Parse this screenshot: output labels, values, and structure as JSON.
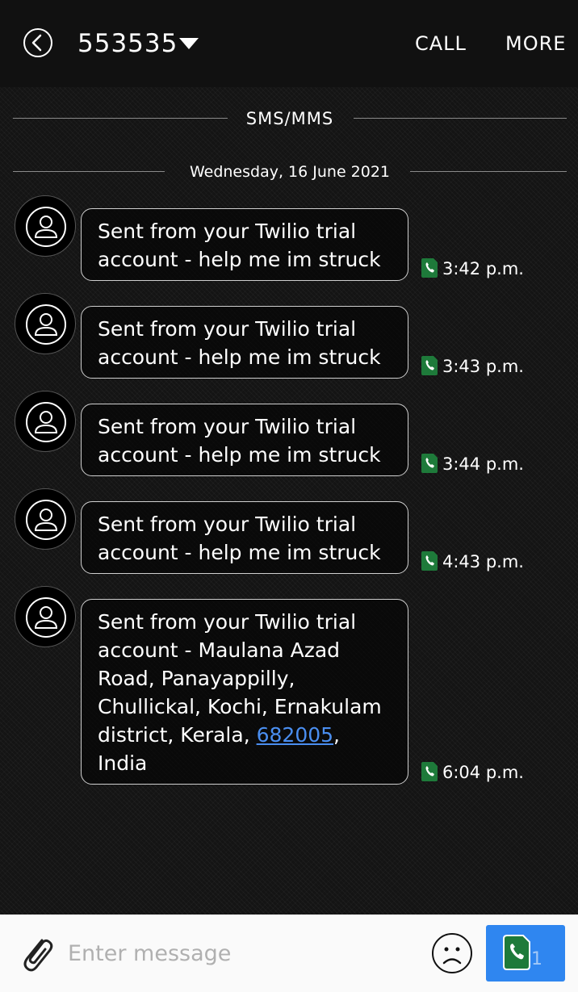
{
  "header": {
    "title": "553535",
    "call_label": "CALL",
    "more_label": "MORE"
  },
  "divider_type": "SMS/MMS",
  "date_label": "Wednesday, 16 June 2021",
  "messages": [
    {
      "text": "Sent from your Twilio trial account - help me im struck",
      "time": "3:42 p.m."
    },
    {
      "text": "Sent from your Twilio trial account - help me im struck",
      "time": "3:43 p.m."
    },
    {
      "text": "Sent from your Twilio trial account - help me im struck",
      "time": "3:44 p.m."
    },
    {
      "text": "Sent from your Twilio trial account - help me im struck",
      "time": "4:43 p.m."
    },
    {
      "text_before": "Sent from your Twilio trial account - Maulana Azad Road, Panayappilly, Chullickal, Kochi, Ernakulam district, Kerala, ",
      "link": "682005",
      "text_after": ", India",
      "time": "6:04 p.m."
    }
  ],
  "composer": {
    "placeholder": "Enter message",
    "sim_badge": "1"
  },
  "icons": {
    "back": "back-circle-icon",
    "dropdown": "triangle-down-icon",
    "avatar": "person-icon",
    "sim": "sim-phone-icon",
    "attach": "paperclip-icon",
    "emoji": "sad-face-icon",
    "send": "sim-phone-icon"
  },
  "colors": {
    "accent": "#2f86f0",
    "sim_green": "#1e7a3a",
    "link": "#4a8ef0"
  }
}
